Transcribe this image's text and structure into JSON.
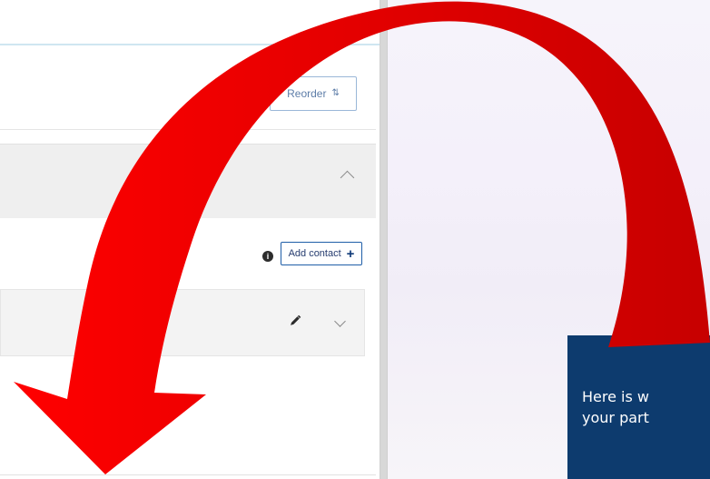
{
  "ui": {
    "reorder_label": "Reorder",
    "add_contact_label": "Add contact",
    "reorder_icon": "sort-arrows-icon",
    "chevron_up_icon": "chevron-up-icon",
    "info_icon": "info-icon",
    "plus_icon": "plus-icon",
    "pencil_icon": "pencil-icon",
    "chevron_down_icon": "chevron-down-icon"
  },
  "callout": {
    "text": "Here is w\nyour part"
  },
  "colors": {
    "accent_blue": "#1f5ea8",
    "callout_bg": "#0d3b6e",
    "arrow_red": "#e10000",
    "arrow_dark_red": "#c80000"
  }
}
